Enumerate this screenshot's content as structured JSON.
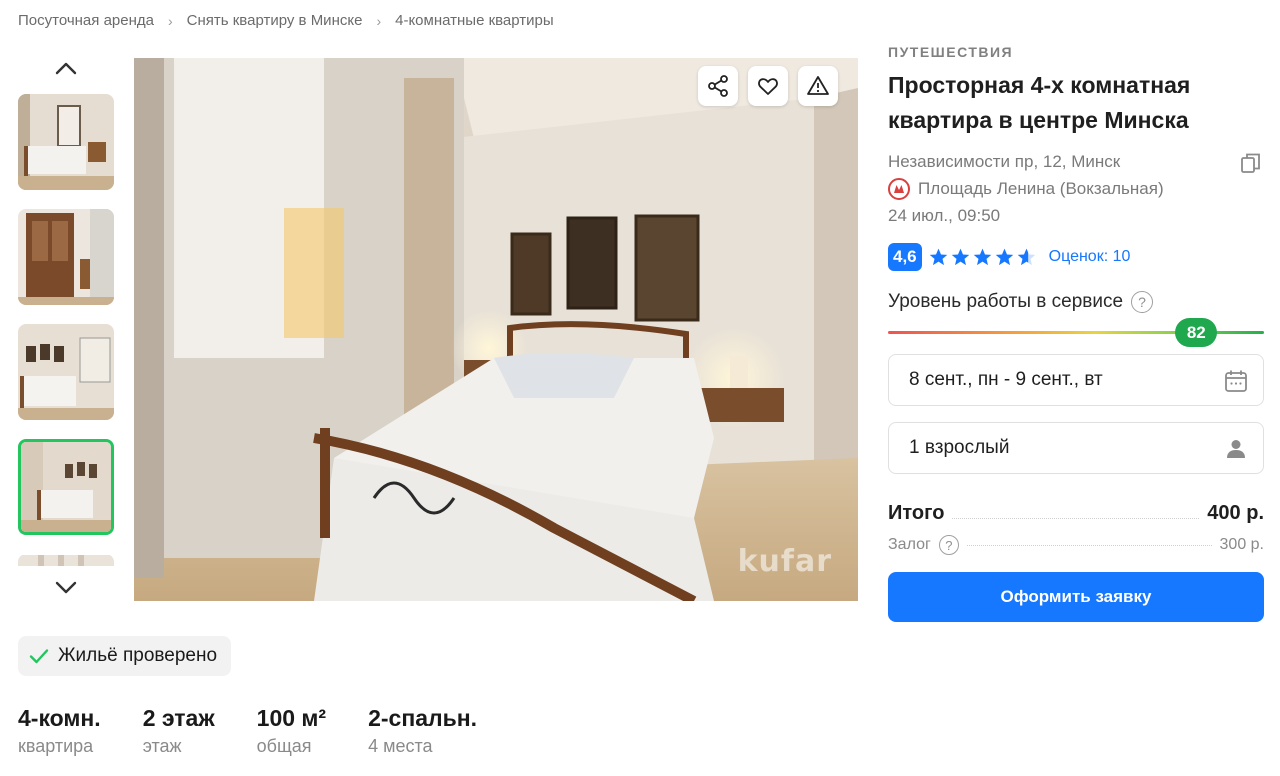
{
  "breadcrumb": {
    "items": [
      "Посуточная аренда",
      "Снять квартиру в Минске",
      "4-комнатные квартиры"
    ]
  },
  "photo": {
    "watermark": "kufar"
  },
  "verified": {
    "label": "Жильё проверено"
  },
  "specs": [
    {
      "value": "4-комн.",
      "label": "квартира"
    },
    {
      "value": "2 этаж",
      "label": "этаж"
    },
    {
      "value": "100 м²",
      "label": "общая"
    },
    {
      "value": "2-спальн.",
      "label": "4 места"
    }
  ],
  "listing": {
    "category": "ПУТЕШЕСТВИЯ",
    "title": "Просторная 4-х комнатная квартира в центре Минска",
    "address": "Независимости пр, 12, Минск",
    "metro": "Площадь Ленина (Вокзальная)",
    "date": "24 июл., 09:50",
    "rating": "4,6",
    "rating_value": 4.6,
    "reviews": "Оценок: 10",
    "service_label": "Уровень работы в сервисе",
    "service_score": "82",
    "service_score_value": 82,
    "dates": "8 сент., пн - 9 сент., вт",
    "guests": "1 взрослый",
    "total_label": "Итого",
    "total_value": "400 р.",
    "deposit_label": "Залог",
    "deposit_value": "300 р.",
    "submit_label": "Оформить заявку",
    "help_glyph": "?"
  },
  "colors": {
    "accent": "#1677ff",
    "success": "#22c55e",
    "service": "#1fa84e",
    "metro": "#d94040"
  }
}
